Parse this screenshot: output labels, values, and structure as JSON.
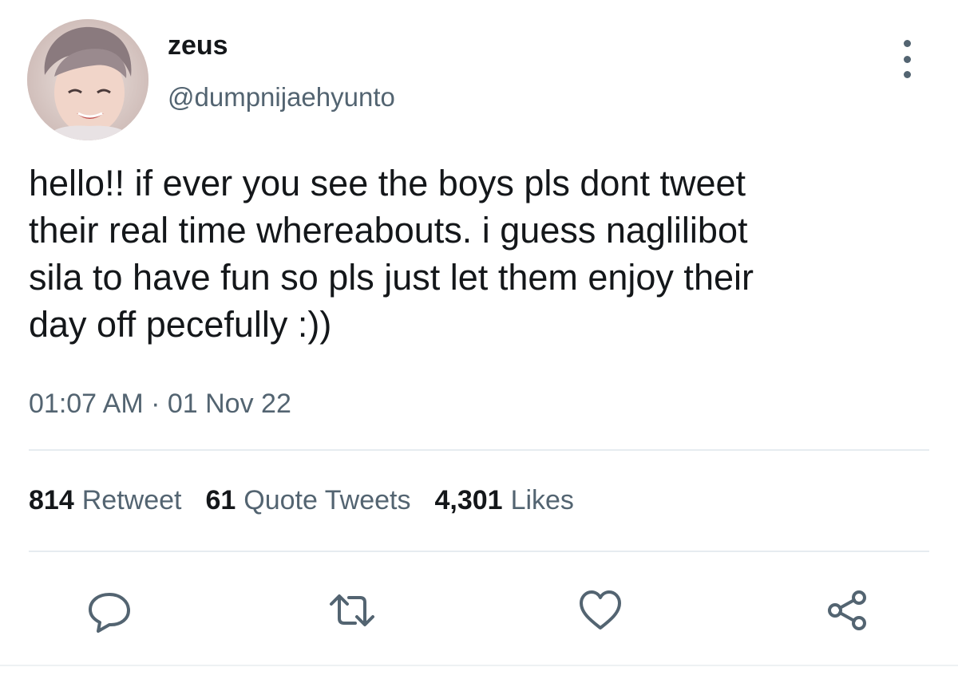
{
  "tweet": {
    "author": {
      "display_name": "zeus",
      "handle": "@dumpnijaehyunto",
      "avatar_icon": "profile-photo"
    },
    "text_lines": [
      "hello!! if ever you see the boys pls dont tweet",
      "their real time whereabouts. i guess naglilibot",
      "sila to have fun so pls just let them enjoy their",
      "day off pecefully :))"
    ],
    "timestamp": "01:07 AM · 01 Nov 22",
    "stats": {
      "retweets": {
        "count": "814",
        "label": "Retweet"
      },
      "quotes": {
        "count": "61",
        "label": "Quote Tweets"
      },
      "likes": {
        "count": "4,301",
        "label": "Likes"
      }
    },
    "actions": [
      "reply-icon",
      "retweet-icon",
      "like-icon",
      "share-icon"
    ],
    "more_icon": "more-vertical-icon"
  },
  "colors": {
    "text_primary": "#14171a",
    "text_secondary": "#536471",
    "divider": "#e6ecf0",
    "background": "#ffffff"
  }
}
